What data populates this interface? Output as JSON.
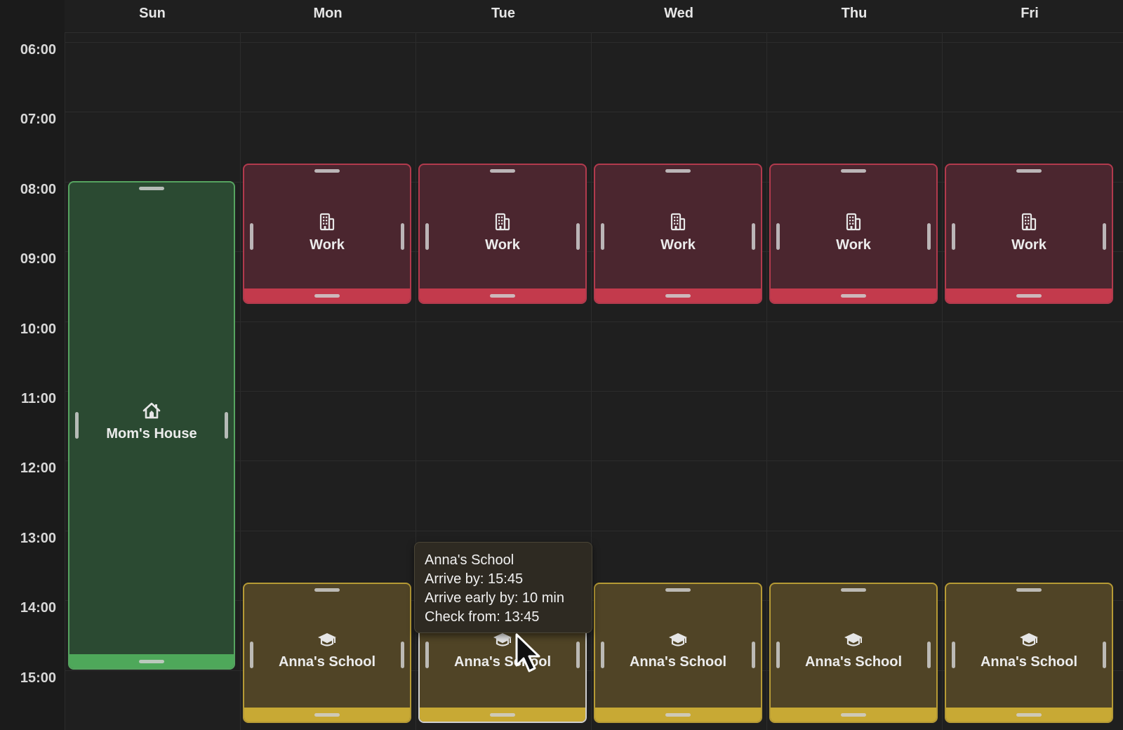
{
  "days": [
    "Sun",
    "Mon",
    "Tue",
    "Wed",
    "Thu",
    "Fri"
  ],
  "times": [
    "06:00",
    "07:00",
    "08:00",
    "09:00",
    "10:00",
    "11:00",
    "12:00",
    "13:00",
    "14:00",
    "15:00"
  ],
  "events": {
    "moms_house": {
      "label": "Mom's House",
      "icon": "house-icon",
      "day": "Sun",
      "color": "#56a460"
    },
    "work": {
      "label": "Work",
      "icon": "building-icon",
      "days": [
        "Mon",
        "Tue",
        "Wed",
        "Thu",
        "Fri"
      ],
      "color": "#c33a4c"
    },
    "school": {
      "label": "Anna's School",
      "icon": "graduation-cap-icon",
      "days": [
        "Mon",
        "Tue",
        "Wed",
        "Thu",
        "Fri"
      ],
      "color": "#c8a934"
    }
  },
  "tooltip": {
    "title": "Anna's School",
    "arrive_by": "Arrive by: 15:45",
    "arrive_early": "Arrive early by: 10 min",
    "check_from": "Check from: 13:45"
  }
}
